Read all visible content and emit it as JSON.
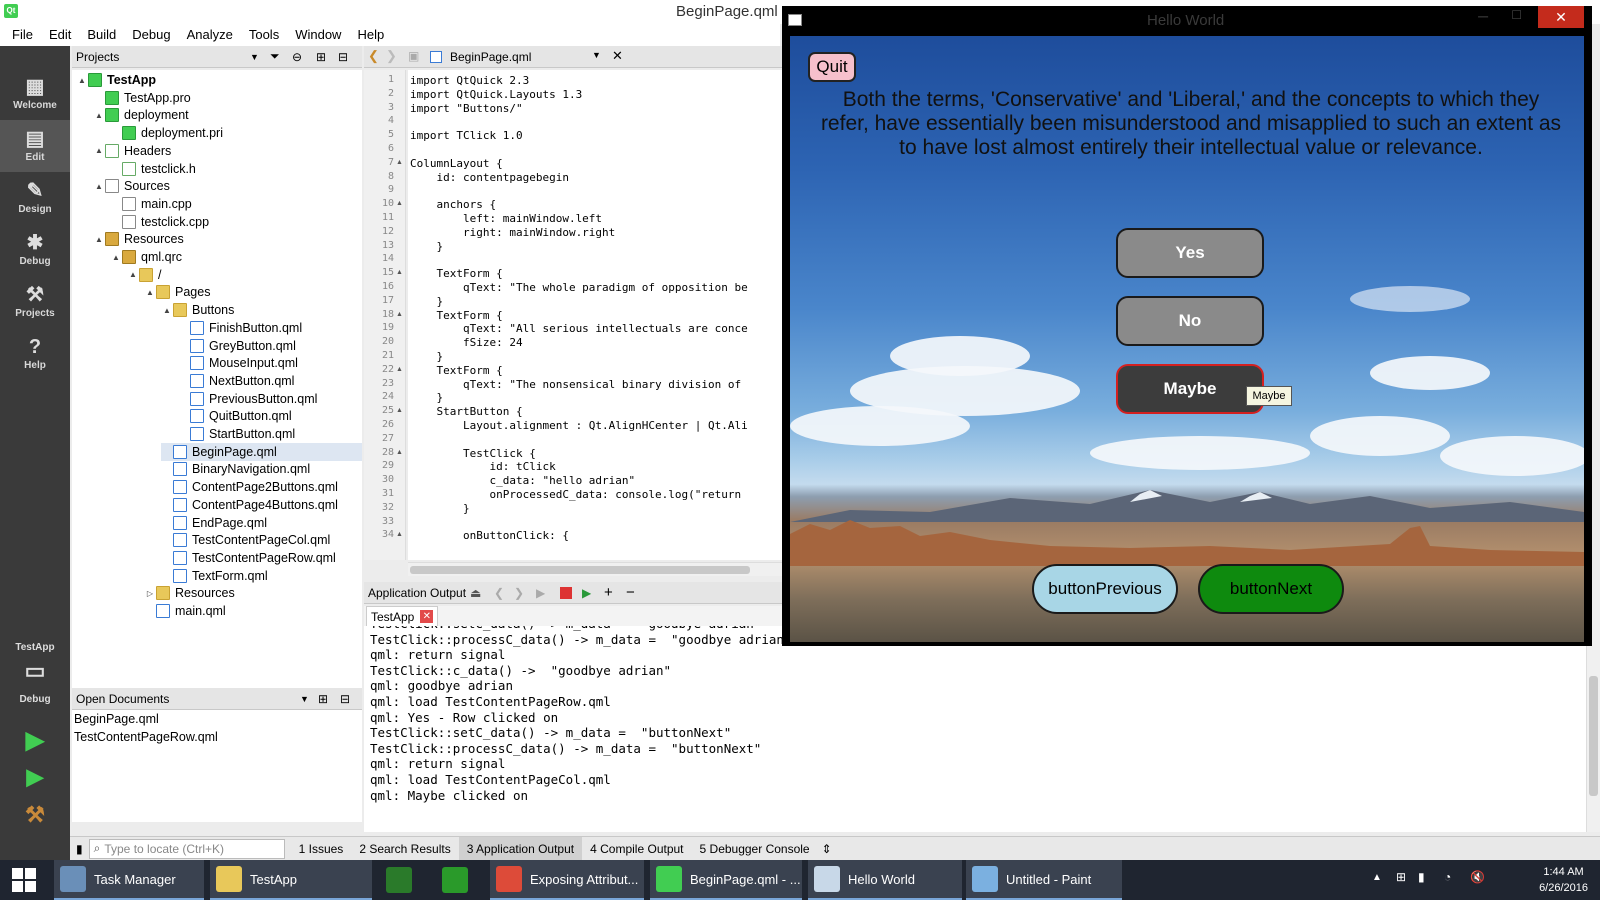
{
  "window": {
    "title": "BeginPage.qml"
  },
  "menu": [
    "File",
    "Edit",
    "Build",
    "Debug",
    "Analyze",
    "Tools",
    "Window",
    "Help"
  ],
  "modes": [
    {
      "label": "Welcome",
      "icon": "grid-icon"
    },
    {
      "label": "Edit",
      "icon": "edit-icon"
    },
    {
      "label": "Design",
      "icon": "pencil-icon"
    },
    {
      "label": "Debug",
      "icon": "bug-icon"
    },
    {
      "label": "Projects",
      "icon": "wrench-icon"
    },
    {
      "label": "Help",
      "icon": "help-icon"
    }
  ],
  "kit": {
    "project": "TestApp",
    "mode": "Debug"
  },
  "projects_panel": {
    "title": "Projects"
  },
  "tree": [
    {
      "label": "TestApp",
      "icon": "proj",
      "level": 0,
      "exp": "▲",
      "bold": true
    },
    {
      "label": "TestApp.pro",
      "icon": "proj",
      "level": 1,
      "exp": ""
    },
    {
      "label": "deployment",
      "icon": "proj",
      "level": 1,
      "exp": "▲"
    },
    {
      "label": "deployment.pri",
      "icon": "proj",
      "level": 2,
      "exp": ""
    },
    {
      "label": "Headers",
      "icon": "hdr",
      "level": 1,
      "exp": "▲"
    },
    {
      "label": "testclick.h",
      "icon": "hdr",
      "level": 2,
      "exp": ""
    },
    {
      "label": "Sources",
      "icon": "file",
      "level": 1,
      "exp": "▲"
    },
    {
      "label": "main.cpp",
      "icon": "file",
      "level": 2,
      "exp": ""
    },
    {
      "label": "testclick.cpp",
      "icon": "file",
      "level": 2,
      "exp": ""
    },
    {
      "label": "Resources",
      "icon": "res",
      "level": 1,
      "exp": "▲"
    },
    {
      "label": "qml.qrc",
      "icon": "res",
      "level": 2,
      "exp": "▲"
    },
    {
      "label": "/",
      "icon": "folder",
      "level": 3,
      "exp": "▲"
    },
    {
      "label": "Pages",
      "icon": "folder",
      "level": 4,
      "exp": "▲"
    },
    {
      "label": "Buttons",
      "icon": "folder",
      "level": 5,
      "exp": "▲"
    },
    {
      "label": "FinishButton.qml",
      "icon": "qml",
      "level": 6,
      "exp": ""
    },
    {
      "label": "GreyButton.qml",
      "icon": "qml",
      "level": 6,
      "exp": ""
    },
    {
      "label": "MouseInput.qml",
      "icon": "qml",
      "level": 6,
      "exp": ""
    },
    {
      "label": "NextButton.qml",
      "icon": "qml",
      "level": 6,
      "exp": ""
    },
    {
      "label": "PreviousButton.qml",
      "icon": "qml",
      "level": 6,
      "exp": ""
    },
    {
      "label": "QuitButton.qml",
      "icon": "qml",
      "level": 6,
      "exp": ""
    },
    {
      "label": "StartButton.qml",
      "icon": "qml",
      "level": 6,
      "exp": ""
    },
    {
      "label": "BeginPage.qml",
      "icon": "qml",
      "level": 5,
      "exp": "",
      "selected": true
    },
    {
      "label": "BinaryNavigation.qml",
      "icon": "qml",
      "level": 5,
      "exp": ""
    },
    {
      "label": "ContentPage2Buttons.qml",
      "icon": "qml",
      "level": 5,
      "exp": ""
    },
    {
      "label": "ContentPage4Buttons.qml",
      "icon": "qml",
      "level": 5,
      "exp": ""
    },
    {
      "label": "EndPage.qml",
      "icon": "qml",
      "level": 5,
      "exp": ""
    },
    {
      "label": "TestContentPageCol.qml",
      "icon": "qml",
      "level": 5,
      "exp": ""
    },
    {
      "label": "TestContentPageRow.qml",
      "icon": "qml",
      "level": 5,
      "exp": ""
    },
    {
      "label": "TextForm.qml",
      "icon": "qml",
      "level": 5,
      "exp": ""
    },
    {
      "label": "Resources",
      "icon": "folder",
      "level": 4,
      "exp": "▷"
    },
    {
      "label": "main.qml",
      "icon": "qml",
      "level": 4,
      "exp": ""
    }
  ],
  "open_documents": {
    "title": "Open Documents",
    "items": [
      "BeginPage.qml",
      "TestContentPageRow.qml"
    ]
  },
  "editor": {
    "file_tab": "BeginPage.qml"
  },
  "code_lines": [
    {
      "n": "1",
      "t": "import QtQuick 2.3"
    },
    {
      "n": "2",
      "t": "import QtQuick.Layouts 1.3"
    },
    {
      "n": "3",
      "t": "import \"Buttons/\""
    },
    {
      "n": "4",
      "t": ""
    },
    {
      "n": "5",
      "t": "import TClick 1.0"
    },
    {
      "n": "6",
      "t": ""
    },
    {
      "n": "7",
      "t": "ColumnLayout {"
    },
    {
      "n": "8",
      "t": "    id: contentpagebegin"
    },
    {
      "n": "9",
      "t": ""
    },
    {
      "n": "10",
      "t": "    anchors {"
    },
    {
      "n": "11",
      "t": "        left: mainWindow.left"
    },
    {
      "n": "12",
      "t": "        right: mainWindow.right"
    },
    {
      "n": "13",
      "t": "    }"
    },
    {
      "n": "14",
      "t": ""
    },
    {
      "n": "15",
      "t": "    TextForm {"
    },
    {
      "n": "16",
      "t": "        qText: \"The whole paradigm of opposition be"
    },
    {
      "n": "17",
      "t": "    }"
    },
    {
      "n": "18",
      "t": "    TextForm {"
    },
    {
      "n": "19",
      "t": "        qText: \"All serious intellectuals are conce"
    },
    {
      "n": "20",
      "t": "        fSize: 24"
    },
    {
      "n": "21",
      "t": "    }"
    },
    {
      "n": "22",
      "t": "    TextForm {"
    },
    {
      "n": "23",
      "t": "        qText: \"The nonsensical binary division of"
    },
    {
      "n": "24",
      "t": "    }"
    },
    {
      "n": "25",
      "t": "    StartButton {"
    },
    {
      "n": "26",
      "t": "        Layout.alignment : Qt.AlignHCenter | Qt.Ali"
    },
    {
      "n": "27",
      "t": ""
    },
    {
      "n": "28",
      "t": "        TestClick {"
    },
    {
      "n": "29",
      "t": "            id: tClick"
    },
    {
      "n": "30",
      "t": "            c_data: \"hello adrian\""
    },
    {
      "n": "31",
      "t": "            onProcessedC_data: console.log(\"return"
    },
    {
      "n": "32",
      "t": "        }"
    },
    {
      "n": "33",
      "t": ""
    },
    {
      "n": "34",
      "t": "        onButtonClick: {"
    }
  ],
  "output_panel": {
    "title": "Application Output",
    "tab": "TestApp"
  },
  "output_lines": [
    "TestClick::setC_data() -> m_data =  \"goodbye adrian\"",
    "TestClick::processC_data() -> m_data =  \"goodbye adrian\"",
    "qml: return signal",
    "TestClick::c_data() ->  \"goodbye adrian\"",
    "qml: goodbye adrian",
    "qml: load TestContentPageRow.qml",
    "qml: Yes - Row clicked on",
    "TestClick::setC_data() -> m_data =  \"buttonNext\"",
    "TestClick::processC_data() -> m_data =  \"buttonNext\"",
    "qml: return signal",
    "qml: load TestContentPageCol.qml",
    "qml: Maybe clicked on"
  ],
  "statusbar": {
    "locate_placeholder": "Type to locate (Ctrl+K)",
    "tabs": [
      "1  Issues",
      "2  Search Results",
      "3  Application Output",
      "4  Compile Output",
      "5  Debugger Console"
    ]
  },
  "hello": {
    "title": "Hello World",
    "quit": "Quit",
    "quote": "Both the terms, 'Conservative' and 'Liberal,' and the concepts to which they refer, have essentially been misunderstood and misapplied to such an extent as to have lost almost entirely their intellectual value or relevance.",
    "yes": "Yes",
    "no": "No",
    "maybe": "Maybe",
    "tooltip": "Maybe",
    "prev": "buttonPrevious",
    "next": "buttonNext"
  },
  "taskbar": {
    "items": [
      {
        "label": "Task Manager",
        "color": "#6a8fb8"
      },
      {
        "label": "TestApp",
        "color": "#e8c85a"
      },
      {
        "label": "",
        "color": "#2a7a2a"
      },
      {
        "label": "",
        "color": "#2a9a2a"
      },
      {
        "label": "Exposing Attribut...",
        "color": "#dd4b39"
      },
      {
        "label": "BeginPage.qml - ...",
        "color": "#41cd52"
      },
      {
        "label": "Hello World",
        "color": "#c8d8e8"
      },
      {
        "label": "Untitled - Paint",
        "color": "#7bb0e0"
      }
    ],
    "time": "1:44 AM",
    "date": "6/26/2016"
  }
}
